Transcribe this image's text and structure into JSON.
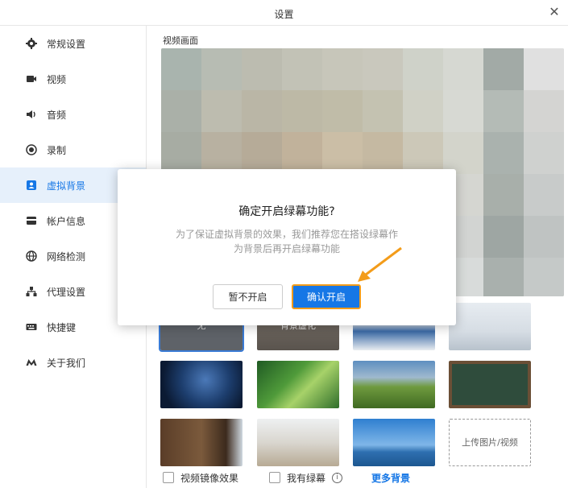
{
  "window": {
    "title": "设置",
    "close_symbol": "✕"
  },
  "sidebar": {
    "items": [
      {
        "label": "常规设置",
        "icon": "gear-icon"
      },
      {
        "label": "视频",
        "icon": "camera-icon"
      },
      {
        "label": "音频",
        "icon": "speaker-icon"
      },
      {
        "label": "录制",
        "icon": "record-icon"
      },
      {
        "label": "虚拟背景",
        "icon": "user-badge-icon",
        "active": true
      },
      {
        "label": "帐户信息",
        "icon": "card-icon"
      },
      {
        "label": "网络检测",
        "icon": "globe-icon"
      },
      {
        "label": "代理设置",
        "icon": "network-icon"
      },
      {
        "label": "快捷键",
        "icon": "keyboard-icon"
      },
      {
        "label": "关于我们",
        "icon": "logo-m-icon"
      }
    ],
    "active_color": "#1677e6",
    "active_bg": "#e6f0fb"
  },
  "main": {
    "video_label": "视频画面",
    "backgrounds": [
      {
        "label": "无",
        "kind": "none"
      },
      {
        "label": "背景虚化",
        "kind": "blur"
      },
      {
        "label": "",
        "kind": "conference-room"
      },
      {
        "label": "",
        "kind": "office-bright"
      },
      {
        "label": "",
        "kind": "star-trails"
      },
      {
        "label": "",
        "kind": "water-drop-leaf"
      },
      {
        "label": "",
        "kind": "green-hills"
      },
      {
        "label": "",
        "kind": "chalkboard"
      },
      {
        "label": "",
        "kind": "bookshelf"
      },
      {
        "label": "",
        "kind": "white-room"
      },
      {
        "label": "",
        "kind": "sky-sea"
      },
      {
        "label": "上传图片/视频",
        "kind": "upload"
      }
    ],
    "mirror_label": "视频镜像效果",
    "greenscreen_label": "我有绿幕",
    "more_label": "更多背景"
  },
  "dialog": {
    "title": "确定开启绿幕功能?",
    "message_line1": "为了保证虚拟背景的效果，我们推荐您在搭设绿幕作",
    "message_line2": "为背景后再开启绿幕功能",
    "cancel_label": "暂不开启",
    "confirm_label": "确认开启",
    "confirm_color": "#1677e6",
    "highlight_color": "#f39c1a"
  }
}
